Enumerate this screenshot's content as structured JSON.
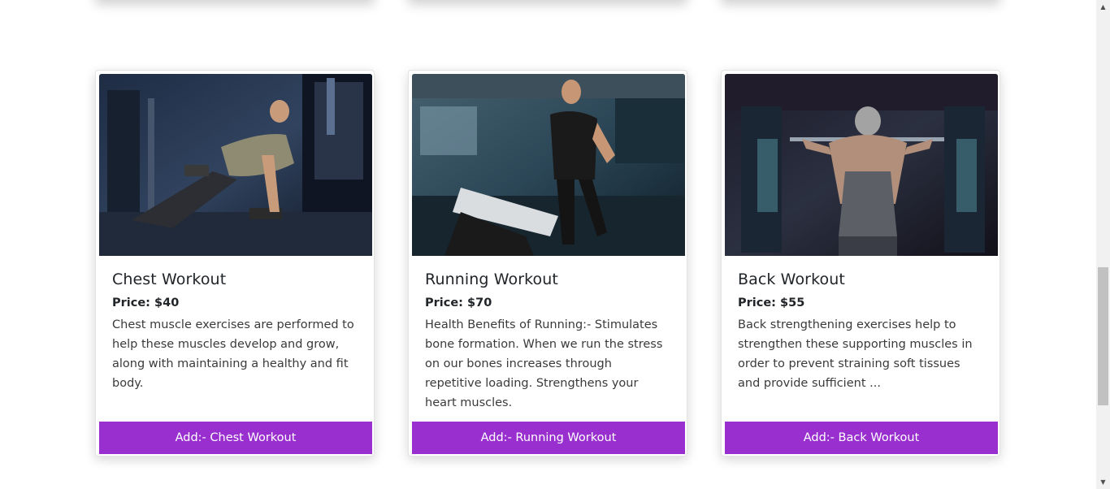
{
  "cards": [
    {
      "title": "Chest Workout",
      "price": "Price: $40",
      "description": "Chest muscle exercises are performed to help these muscles develop and grow, along with maintaining a healthy and fit body.",
      "button_label": "Add:- Chest Workout"
    },
    {
      "title": "Running Workout",
      "price": "Price: $70",
      "description": "Health Benefits of Running:- Stimulates bone formation. When we run the stress on our bones increases through repetitive loading. Strengthens your heart muscles.",
      "button_label": "Add:- Running Workout"
    },
    {
      "title": "Back Workout",
      "price": "Price: $55",
      "description": "Back strengthening exercises help to strengthen these supporting muscles in order to prevent straining soft tissues and provide sufficient ...",
      "button_label": "Add:- Back Workout"
    }
  ],
  "colors": {
    "button_bg": "#9a2fcf",
    "button_text": "#ffffff"
  }
}
